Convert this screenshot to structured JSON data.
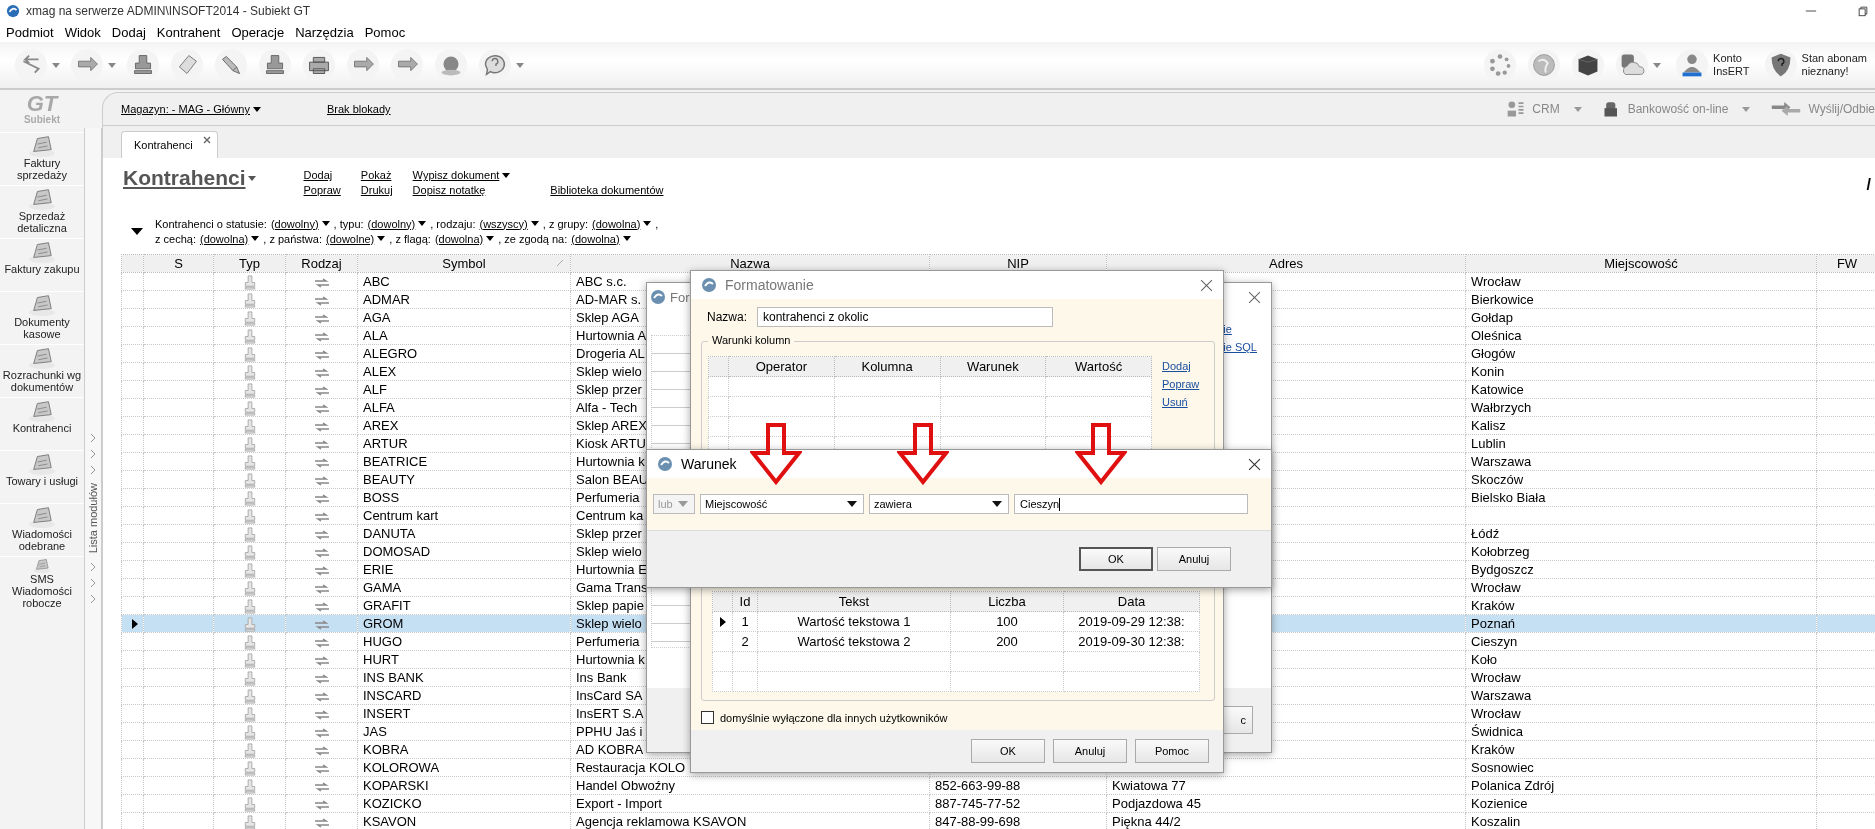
{
  "window": {
    "title": "xmag na serwerze ADMIN\\INSOFT2014 - Subiekt GT"
  },
  "menu": [
    "Podmiot",
    "Widok",
    "Dodaj",
    "Kontrahent",
    "Operacje",
    "Narzędzia",
    "Pomoc"
  ],
  "account": {
    "line1": "Konto",
    "line2": "InsERT"
  },
  "subscription": {
    "line1": "Stan abonam",
    "line2": "nieznany!"
  },
  "sidebar": {
    "logo_mark": "GT",
    "logo_text": "Subiekt",
    "strip_label": "Lista modułów",
    "items": [
      {
        "label": "Faktury sprzedaży"
      },
      {
        "label": "Sprzedaż detaliczna"
      },
      {
        "label": "Faktury zakupu"
      },
      {
        "label": "Dokumenty kasowe"
      },
      {
        "label": "Rozrachunki wg dokumentów"
      },
      {
        "label": "Kontrahenci"
      },
      {
        "label": "Towary i usługi"
      },
      {
        "label": "Wiadomości odebrane"
      },
      {
        "label": "SMS Wiadomości robocze"
      }
    ]
  },
  "topbar": {
    "warehouse": "Magazyn: - MAG - Główny",
    "lock": "Brak blokady",
    "actions": [
      {
        "label": "CRM",
        "dropdown": true
      },
      {
        "label": "Bankowość on-line",
        "dropdown": true
      },
      {
        "label": "Wyślij/Odbie",
        "dropdown": false
      }
    ]
  },
  "tabs": [
    {
      "label": "Kontrahenci",
      "selected": true
    }
  ],
  "heading": "Kontrahenci",
  "page_count": "/",
  "actions": [
    [
      {
        "label": "Dodaj",
        "dropdown": false
      },
      {
        "label": "Popraw",
        "dropdown": false
      }
    ],
    [
      {
        "label": "Pokaż",
        "dropdown": false
      },
      {
        "label": "Drukuj",
        "dropdown": false
      }
    ],
    [
      {
        "label": "Wypisz dokument",
        "dropdown": true
      },
      {
        "label": "Dopisz notatkę",
        "dropdown": false
      }
    ],
    [
      {
        "label": "Biblioteka dokumentów",
        "dropdown": false
      }
    ]
  ],
  "filters": [
    [
      {
        "kind": "label",
        "text": "Kontrahenci o statusie:"
      },
      {
        "kind": "dropdown",
        "text": "(dowolny)"
      },
      {
        "kind": "label",
        "text": ", typu:"
      },
      {
        "kind": "dropdown",
        "text": "(dowolny)"
      },
      {
        "kind": "label",
        "text": ", rodzaju:"
      },
      {
        "kind": "dropdown",
        "text": "(wszyscy)"
      },
      {
        "kind": "label",
        "text": ", z grupy:"
      },
      {
        "kind": "dropdown",
        "text": "(dowolna)"
      },
      {
        "kind": "label",
        "text": ","
      }
    ],
    [
      {
        "kind": "label",
        "text": "z cechą:"
      },
      {
        "kind": "dropdown",
        "text": "(dowolna)"
      },
      {
        "kind": "label",
        "text": ", z państwa:"
      },
      {
        "kind": "dropdown",
        "text": "(dowolne)"
      },
      {
        "kind": "label",
        "text": ", z flagą:"
      },
      {
        "kind": "dropdown",
        "text": "(dowolna)"
      },
      {
        "kind": "label",
        "text": ", ze zgodą na:"
      },
      {
        "kind": "dropdown",
        "text": "(dowolna)"
      }
    ]
  ],
  "table": {
    "columns": [
      "S",
      "Typ",
      "Rodzaj",
      "Symbol",
      "Nazwa",
      "NIP",
      "Adres",
      "Miejscowość",
      "FW"
    ],
    "rows": [
      {
        "symbol": "ABC",
        "name": "ABC s.c.",
        "city": "Wrocław",
        "selected": false
      },
      {
        "symbol": "ADMAR",
        "name": "AD-MAR s.",
        "city": "Bierkowice",
        "selected": false
      },
      {
        "symbol": "AGA",
        "name": "Sklep AGA",
        "city": "Gołdap",
        "selected": false
      },
      {
        "symbol": "ALA",
        "name": "Hurtownia A",
        "city": "Oleśnica",
        "selected": false
      },
      {
        "symbol": "ALEGRO",
        "name": "Drogeria AL",
        "city": "Głogów",
        "selected": false
      },
      {
        "symbol": "ALEX",
        "name": "Sklep wielo",
        "city": "Konin",
        "selected": false
      },
      {
        "symbol": "ALF",
        "name": "Sklep przer",
        "city": "Katowice",
        "selected": false
      },
      {
        "symbol": "ALFA",
        "name": "Alfa - Tech",
        "city": "Wałbrzych",
        "selected": false
      },
      {
        "symbol": "AREX",
        "name": "Sklep AREX",
        "city": "Kalisz",
        "selected": false
      },
      {
        "symbol": "ARTUR",
        "name": "Kiosk ARTU",
        "city": "Lublin",
        "selected": false
      },
      {
        "symbol": "BEATRICE",
        "name": "Hurtownia k",
        "city": "Warszawa",
        "selected": false
      },
      {
        "symbol": "BEAUTY",
        "name": "Salon BEAU",
        "city": "Skoczów",
        "selected": false
      },
      {
        "symbol": "BOSS",
        "name": "Perfumeria",
        "city": "Bielsko Biała",
        "selected": false
      },
      {
        "symbol": "Centrum kart",
        "name": "Centrum ka",
        "selected": false
      },
      {
        "symbol": "DANUTA",
        "name": "Sklep przer",
        "city": "Łódź",
        "selected": false
      },
      {
        "symbol": "DOMOSAD",
        "name": "Sklep wielo",
        "city": "Kołobrzeg",
        "selected": false
      },
      {
        "symbol": "ERIE",
        "name": "Hurtownia E",
        "city": "Bydgoszcz",
        "selected": false
      },
      {
        "symbol": "GAMA",
        "name": "Gama Trans",
        "city": "Wrocław",
        "selected": false
      },
      {
        "symbol": "GRAFIT",
        "name": "Sklep papie",
        "city": "Kraków",
        "selected": false
      },
      {
        "symbol": "GROM",
        "name": "Sklep wielo",
        "city": "Poznań",
        "selected": true
      },
      {
        "symbol": "HUGO",
        "name": "Perfumeria",
        "city": "Cieszyn",
        "selected": false
      },
      {
        "symbol": "HURT",
        "name": "Hurtownia k",
        "city": "Koło",
        "selected": false
      },
      {
        "symbol": "INS BANK",
        "name": "Ins Bank",
        "city": "Wrocław",
        "selected": false
      },
      {
        "symbol": "INSCARD",
        "name": "InsCard SA",
        "city": "Warszawa",
        "selected": false
      },
      {
        "symbol": "INSERT",
        "name": "InsERT S.A",
        "city": "Wrocław",
        "selected": false
      },
      {
        "symbol": "JAS",
        "name": "PPHU Jaś i",
        "city": "Świdnica",
        "selected": false
      },
      {
        "symbol": "KOBRA",
        "name": "AD KOBRA",
        "city": "Kraków",
        "selected": false
      },
      {
        "symbol": "KOLOROWA",
        "name": "Restauracja KOLO",
        "city": "Sosnowiec",
        "selected": false
      },
      {
        "symbol": "KOPARSKI",
        "name": "Handel Obwoźny",
        "nip": "852-663-99-88",
        "address": "Kwiatowa  77",
        "city": "Polanica Zdrój",
        "selected": false
      },
      {
        "symbol": "KOZICKO",
        "name": "Export - Import",
        "nip": "887-745-77-52",
        "address": "Podjazdowa 45",
        "city": "Kozienice",
        "selected": false
      },
      {
        "symbol": "KSAVON",
        "name": "Agencja reklamowa KSAVON",
        "nip": "847-88-99-698",
        "address": "Piękna  44/2",
        "city": "Koszalin",
        "selected": false
      }
    ]
  },
  "back_dialog": {
    "title": "For",
    "links": [
      "ie",
      "ie SQL"
    ],
    "button": "c"
  },
  "format_dialog": {
    "title": "Formatowanie",
    "name_label": "Nazwa:",
    "name_value": "kontrahenci z okolic",
    "group_title": "Warunki kolumn",
    "condition_columns": [
      "Operator",
      "Kolumna",
      "Warunek",
      "Wartość"
    ],
    "links": [
      "Dodaj",
      "Popraw",
      "Usuń"
    ],
    "preview": {
      "columns": [
        "Id",
        "Tekst",
        "Liczba",
        "Data"
      ],
      "rows": [
        {
          "id": "1",
          "text": "Wartość tekstowa 1",
          "number": "100",
          "date": "2019-09-29 12:38:",
          "selected": true
        },
        {
          "id": "2",
          "text": "Wartość tekstowa 2",
          "number": "200",
          "date": "2019-09-30 12:38:",
          "selected": false
        }
      ]
    },
    "checkbox": {
      "label": "domyślnie wyłączone dla innych użytkowników",
      "checked": false
    },
    "buttons": [
      "OK",
      "Anuluj",
      "Pomoc"
    ]
  },
  "condition_dialog": {
    "title": "Warunek",
    "operator": {
      "value": "lub",
      "disabled": true
    },
    "column": "Miejscowość",
    "condition": "zawiera",
    "value": "Cieszyn",
    "buttons": [
      {
        "label": "OK",
        "default": true
      },
      {
        "label": "Anuluj",
        "default": false
      }
    ]
  }
}
